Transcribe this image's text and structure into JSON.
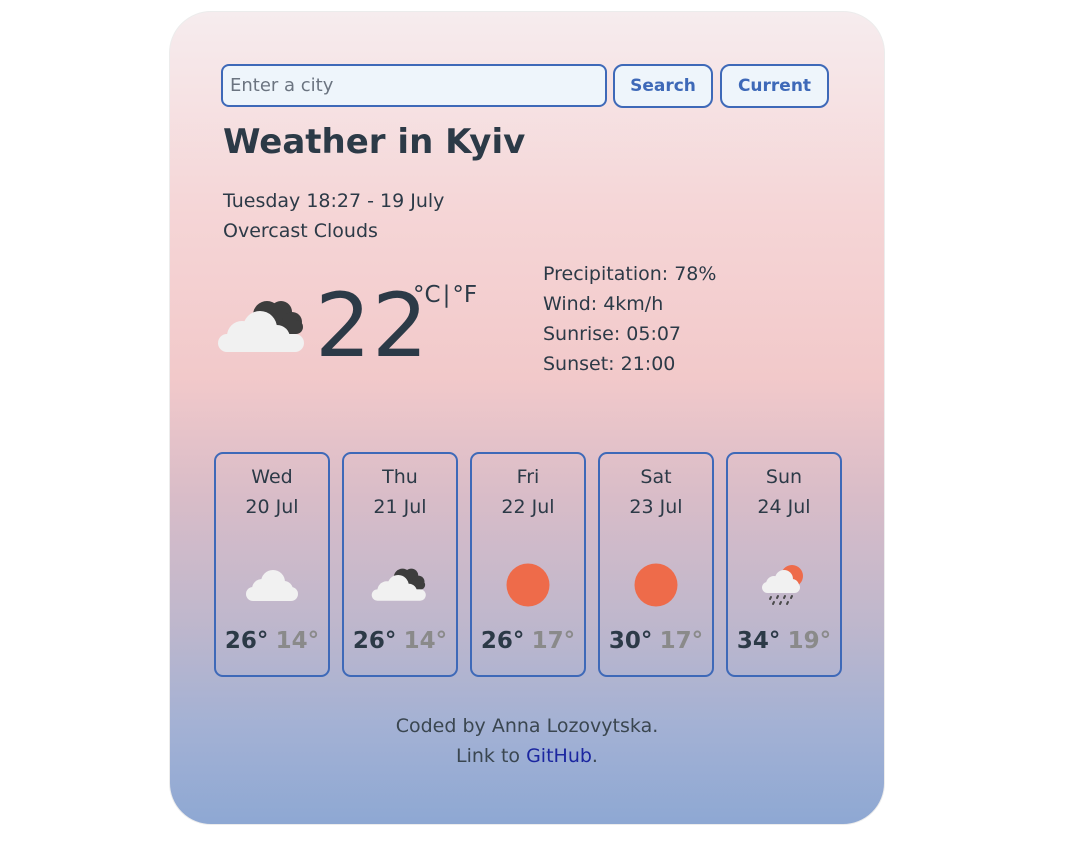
{
  "search": {
    "placeholder": "Enter a city",
    "value": ""
  },
  "buttons": {
    "search": "Search",
    "current": "Current"
  },
  "header": {
    "title": "Weather in Kyiv",
    "datetime": "Tuesday 18:27 - 19 July",
    "description": "Overcast Clouds"
  },
  "current": {
    "icon": "broken-clouds-icon",
    "temperature": "22",
    "unit_c": "°C",
    "separator": "|",
    "unit_f": "°F"
  },
  "details": {
    "precipitation": "Precipitation: 78%",
    "wind": "Wind: 4km/h",
    "sunrise": "Sunrise: 05:07",
    "sunset": "Sunset: 21:00"
  },
  "forecast": [
    {
      "day": "Wed",
      "date": "20 Jul",
      "icon": "cloud-icon",
      "max": "26°",
      "min": "14°"
    },
    {
      "day": "Thu",
      "date": "21 Jul",
      "icon": "broken-clouds-icon",
      "max": "26°",
      "min": "14°"
    },
    {
      "day": "Fri",
      "date": "22 Jul",
      "icon": "sun-icon",
      "max": "26°",
      "min": "17°"
    },
    {
      "day": "Sat",
      "date": "23 Jul",
      "icon": "sun-icon",
      "max": "30°",
      "min": "17°"
    },
    {
      "day": "Sun",
      "date": "24 Jul",
      "icon": "sun-rain-icon",
      "max": "34°",
      "min": "19°"
    }
  ],
  "footer": {
    "credit": "Coded by Anna Lozovytska.",
    "link_prefix": "Link to ",
    "link_text": "GitHub",
    "link_suffix": "."
  },
  "colors": {
    "accent": "#3e69b8",
    "sun": "#ee6b4a",
    "link": "#1b26a0"
  }
}
